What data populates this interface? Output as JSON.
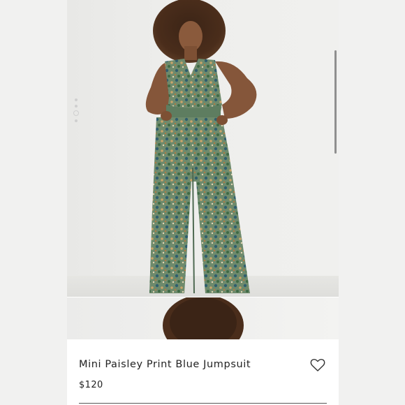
{
  "product": {
    "title": "Mini Paisley Print Blue Jumpsuit",
    "price": "$120"
  },
  "carousel": {
    "image_count": 4,
    "active_index": 2
  },
  "icons": {
    "like": "heart-outline-icon"
  },
  "colors": {
    "fabric_green": "#5f7d62",
    "text": "#222222",
    "background": "#ffffff"
  }
}
